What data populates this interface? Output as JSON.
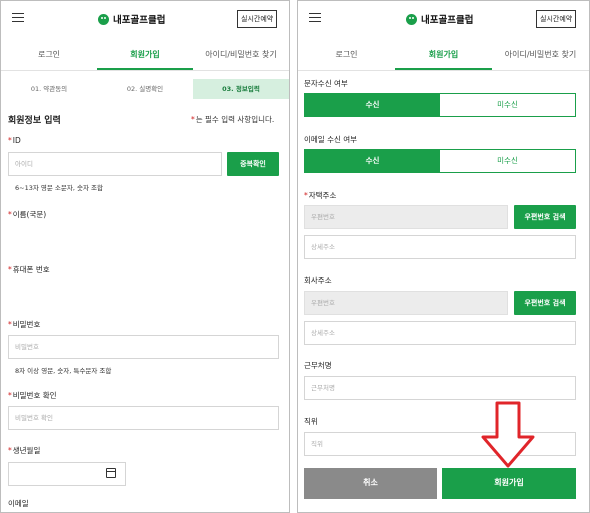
{
  "header": {
    "brand": "내포골프클럽",
    "realtime_button": "실시간예약"
  },
  "tabs": [
    "로그인",
    "회원가입",
    "아이디/비밀번호 찾기"
  ],
  "steps": [
    "01. 약관동의",
    "02. 실명확인",
    "03. 정보입력"
  ],
  "left": {
    "section_title": "회원정보 입력",
    "required_note": "는 필수 입력 사항입니다.",
    "req_mark": "*",
    "id_label": "ID",
    "id_placeholder": "아이디",
    "id_check_button": "중복확인",
    "id_hint": "6~13자 영문 소문자, 숫자 조합",
    "name_label": "이름(국문)",
    "phone_label": "휴대폰 번호",
    "password_label": "비밀번호",
    "password_placeholder": "비밀번호",
    "password_hint": "8자 이상 영문, 숫자, 특수문자 조합",
    "password_confirm_label": "비밀번호 확인",
    "password_confirm_placeholder": "비밀번호 확인",
    "birthday_label": "생년월일",
    "email_label": "이메일"
  },
  "right": {
    "sms_label": "문자수신 여부",
    "email_receive_label": "이메일 수신 여부",
    "receive_yes": "수신",
    "receive_no": "미수신",
    "home_address_label": "자택주소",
    "postcode_placeholder": "우편번호",
    "postcode_search": "우편번호 검색",
    "detail_address_placeholder": "상세주소",
    "company_address_label": "회사주소",
    "workplace_label": "근무처명",
    "workplace_placeholder": "근무처명",
    "position_label": "직위",
    "position_placeholder": "직위",
    "cancel_button": "취소",
    "join_button": "회원가입"
  },
  "colors": {
    "accent": "#1a9f4a",
    "required": "#d12020",
    "arrow": "#e0252a"
  }
}
